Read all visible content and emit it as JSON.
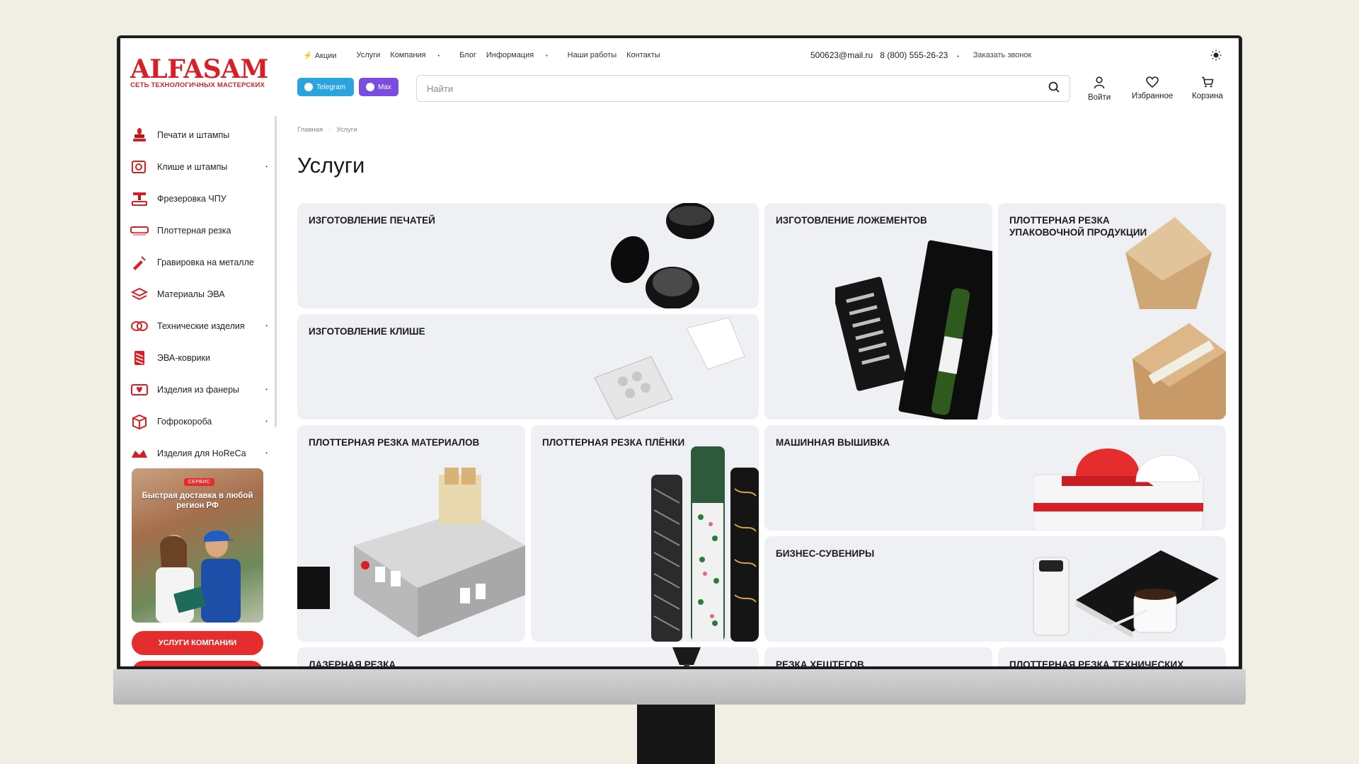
{
  "brand": {
    "name": "ALFASAM",
    "tagline": "СЕТЬ ТЕХНОЛОГИЧНЫХ МАСТЕРСКИХ",
    "accent": "#d81f26"
  },
  "topnav": {
    "items": [
      {
        "label": "Акции",
        "icon": "bolt-icon"
      },
      {
        "label": "Услуги"
      },
      {
        "label": "Компания",
        "dropdown": true
      },
      {
        "label": "Блог"
      },
      {
        "label": "Информация",
        "dropdown": true
      },
      {
        "label": "Наши работы"
      },
      {
        "label": "Контакты"
      }
    ]
  },
  "contacts": {
    "email": "500623@mail.ru",
    "phone": "8 (800) 555-26-23",
    "callback": "Заказать звонок"
  },
  "messengers": {
    "telegram": "Telegram",
    "max": "Max"
  },
  "search": {
    "placeholder": "Найти"
  },
  "user_actions": {
    "login": "Войти",
    "favorites": "Избранное",
    "cart": "Корзина"
  },
  "sidebar": {
    "items": [
      {
        "label": "Печати и штампы",
        "icon": "stamp-icon",
        "has_children": false
      },
      {
        "label": "Клише и штампы",
        "icon": "cliche-icon",
        "has_children": true
      },
      {
        "label": "Фрезеровка ЧПУ",
        "icon": "cnc-icon",
        "has_children": false
      },
      {
        "label": "Плоттерная резка",
        "icon": "plotter-icon",
        "has_children": false
      },
      {
        "label": "Гравировка на металле",
        "icon": "engraving-icon",
        "has_children": false
      },
      {
        "label": "Материалы ЭВА",
        "icon": "eva-material-icon",
        "has_children": false
      },
      {
        "label": "Технические изделия",
        "icon": "technical-icon",
        "has_children": true
      },
      {
        "label": "ЭВА-коврики",
        "icon": "mat-icon",
        "has_children": false
      },
      {
        "label": "Изделия из фанеры",
        "icon": "plywood-icon",
        "has_children": true
      },
      {
        "label": "Гофрокороба",
        "icon": "box-icon",
        "has_children": true
      },
      {
        "label": "Изделия для HoReCa",
        "icon": "horeca-icon",
        "has_children": true
      }
    ],
    "promo": {
      "badge": "СЕРВИС",
      "text": "Быстрая доставка в любой регион РФ"
    },
    "services_button": "УСЛУГИ КОМПАНИИ"
  },
  "breadcrumb": {
    "home": "Главная",
    "current": "Услуги"
  },
  "page": {
    "title": "Услуги"
  },
  "services": [
    {
      "title": "ИЗГОТОВЛЕНИЕ ПЕЧАТЕЙ"
    },
    {
      "title": "ИЗГОТОВЛЕНИЕ ЛОЖЕМЕНТОВ"
    },
    {
      "title": "ПЛОТТЕРНАЯ РЕЗКА УПАКОВОЧНОЙ ПРОДУКЦИИ"
    },
    {
      "title": "ИЗГОТОВЛЕНИЕ КЛИШЕ"
    },
    {
      "title": "ПЛОТТЕРНАЯ РЕЗКА МАТЕРИАЛОВ"
    },
    {
      "title": "ПЛОТТЕРНАЯ РЕЗКА ПЛЁНКИ"
    },
    {
      "title": "МАШИННАЯ ВЫШИВКА"
    },
    {
      "title": "БИЗНЕС-СУВЕНИРЫ"
    },
    {
      "title": "ЛАЗЕРНАЯ РЕЗКА"
    },
    {
      "title": "РЕЗКА ХЕШТЕГОВ"
    },
    {
      "title": "ПЛОТТЕРНАЯ РЕЗКА ТЕХНИЧЕСКИХ"
    }
  ]
}
